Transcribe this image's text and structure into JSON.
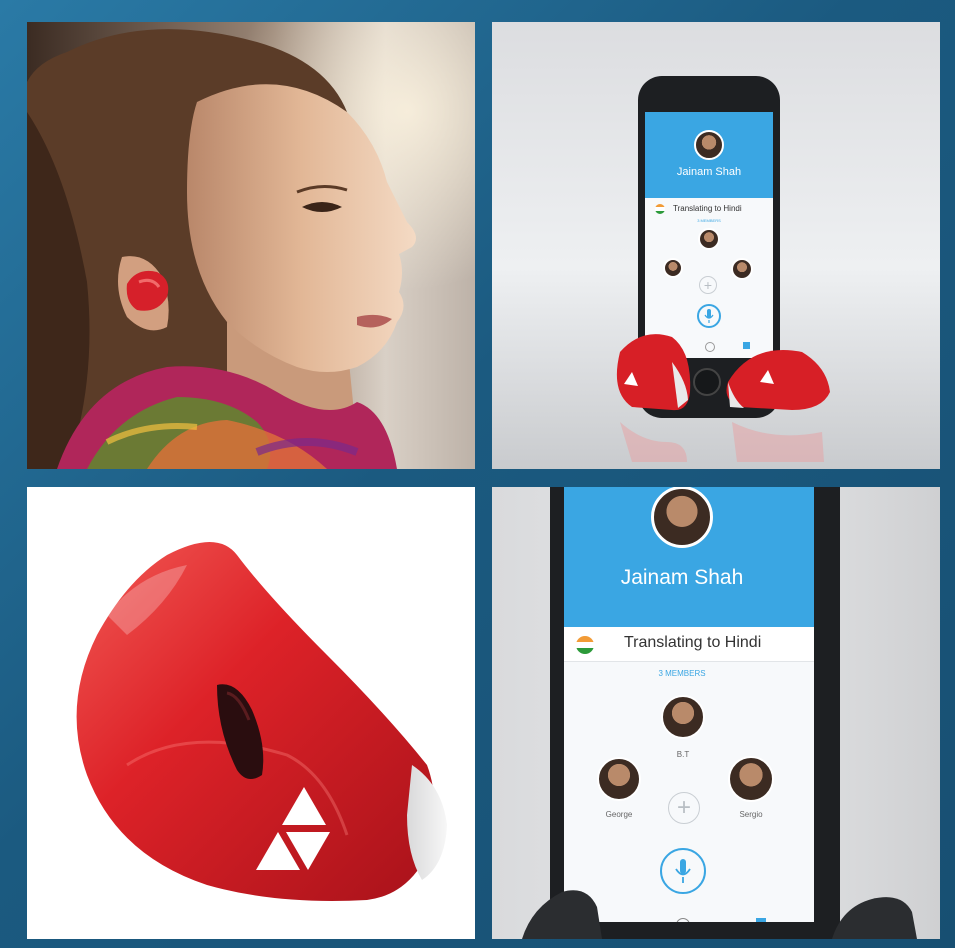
{
  "panels": {
    "top_right": {
      "contact_name": "Jainam Shah",
      "translating": "Translating to Hindi",
      "members_label": "3 MEMBERS"
    },
    "bottom_right": {
      "contact_name": "Jainam Shah",
      "translating": "Translating to Hindi",
      "members_label": "3 MEMBERS",
      "member_top": "B.T",
      "member_left": "George",
      "member_right": "Sergio"
    }
  },
  "colors": {
    "frame": "#1f5f86",
    "app_blue": "#3aa6e3",
    "earbud_red": "#d71f26"
  },
  "icons": [
    "mic-icon",
    "plus-icon",
    "globe-icon",
    "chat-icon",
    "india-flag-icon",
    "logo-triangles-icon"
  ]
}
